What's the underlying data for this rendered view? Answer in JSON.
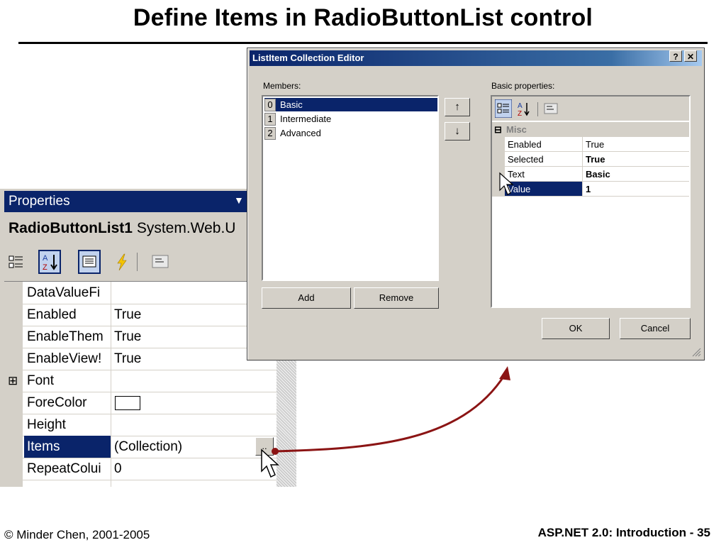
{
  "slide": {
    "title": "Define Items in RadioButtonList control",
    "footer_left": "© Minder Chen, 2001-2005",
    "footer_right": "ASP.NET 2.0: Introduction  - 35"
  },
  "properties_window": {
    "title": "Properties",
    "object_name": "RadioButtonList1",
    "object_type": "System.Web.U",
    "rows": [
      {
        "name": "DataValueFi",
        "value": ""
      },
      {
        "name": "Enabled",
        "value": "True"
      },
      {
        "name": "EnableThem",
        "value": "True"
      },
      {
        "name": "EnableView!",
        "value": "True"
      },
      {
        "name": "Font",
        "value": "",
        "expander": "⊞"
      },
      {
        "name": "ForeColor",
        "value": ""
      },
      {
        "name": "Height",
        "value": ""
      },
      {
        "name": "Items",
        "value": "(Collection)",
        "selected": true
      },
      {
        "name": "RepeatColui",
        "value": "0"
      },
      {
        "name": "",
        "value": ""
      }
    ],
    "ellipsis_label": ".."
  },
  "collection_editor": {
    "title": "ListItem Collection Editor",
    "help_label": "?",
    "close_label": "✕",
    "members_label": "Members:",
    "members": [
      {
        "index": "0",
        "text": "Basic",
        "selected": true
      },
      {
        "index": "1",
        "text": "Intermediate"
      },
      {
        "index": "2",
        "text": "Advanced"
      }
    ],
    "move_up_label": "↑",
    "move_down_label": "↓",
    "add_label": "Add",
    "remove_label": "Remove",
    "basic_properties_label": "Basic properties:",
    "category": "Misc",
    "category_expander": "⊟",
    "properties": [
      {
        "name": "Enabled",
        "value": "True",
        "bold": false
      },
      {
        "name": "Selected",
        "value": "True",
        "bold": true
      },
      {
        "name": "Text",
        "value": "Basic",
        "bold": true
      },
      {
        "name": "Value",
        "value": "1",
        "bold": true,
        "selected": true
      }
    ],
    "ok_label": "OK",
    "cancel_label": "Cancel"
  },
  "colors": {
    "titlebar_active": "#0a246a",
    "selection": "#0a246a",
    "connector_arrow": "#8b1414",
    "face": "#d4d0c8"
  }
}
